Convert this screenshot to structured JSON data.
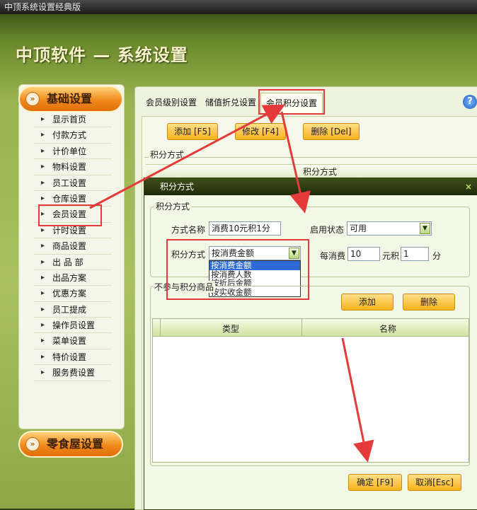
{
  "window": {
    "title": "中顶系统设置经典版"
  },
  "app_title": "中顶软件 — 系统设置",
  "sidebar": {
    "section1": "基础设置",
    "items": [
      "显示首页",
      "付款方式",
      "计价单位",
      "物料设置",
      "员工设置",
      "仓库设置",
      "会员设置",
      "计时设置",
      "商品设置",
      "出 品 部",
      "出品方案",
      "优惠方案",
      "员工提成",
      "操作员设置",
      "菜单设置",
      "特价设置",
      "服务费设置"
    ],
    "section2": "零食屋设置"
  },
  "tabs": [
    "会员级别设置",
    "储值折兑设置",
    "会员积分设置"
  ],
  "toolbar": {
    "add": "添加 [F5]",
    "edit": "修改 [F4]",
    "delete": "删除 [Del]"
  },
  "bg_section": {
    "label": "积分方式",
    "column": "积分方式"
  },
  "dialog": {
    "title": "积分方式",
    "group_label": "积分方式",
    "name_label": "方式名称",
    "name_value": "消费10元积1分",
    "status_label": "启用状态",
    "status_value": "可用",
    "mode_label": "积分方式",
    "mode_value": "按消费金额",
    "mode_options": [
      "按消费金额",
      "按消费人数",
      "按折后金额",
      "按实收金额"
    ],
    "per_label": "每消费",
    "per_value": "10",
    "yuan_label": "元积",
    "points_value": "1",
    "fen_label": "分",
    "excl_label": "不参与积分商品",
    "add_btn": "添加",
    "delete_btn": "删除",
    "col_type": "类型",
    "col_name": "名称",
    "ok_btn": "确定 [F9]",
    "cancel_btn": "取消[Esc]"
  },
  "colors": {
    "highlight": "#e53a3a",
    "accent": "#f8b21c"
  }
}
